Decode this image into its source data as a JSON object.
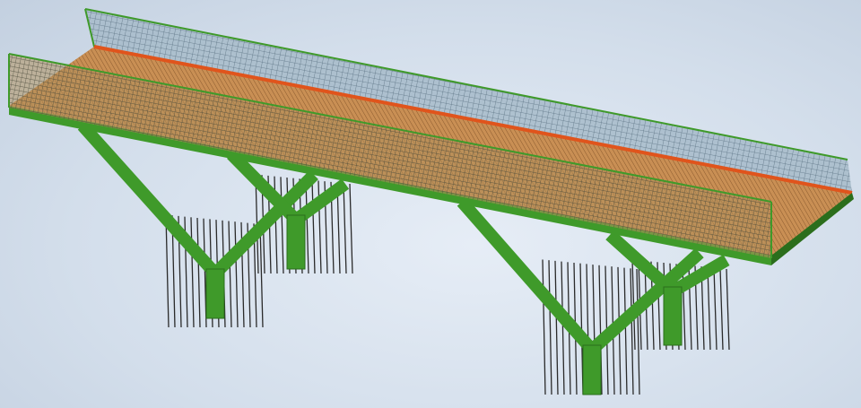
{
  "scene": {
    "colors": {
      "steel": "#3f9a2a",
      "steel_dark": "#2b6e1c",
      "deck": "#c98f54",
      "deck_edge": "#e0541c",
      "railing_mesh": "#7f96a8",
      "rebar": "#2a2a2a"
    }
  }
}
